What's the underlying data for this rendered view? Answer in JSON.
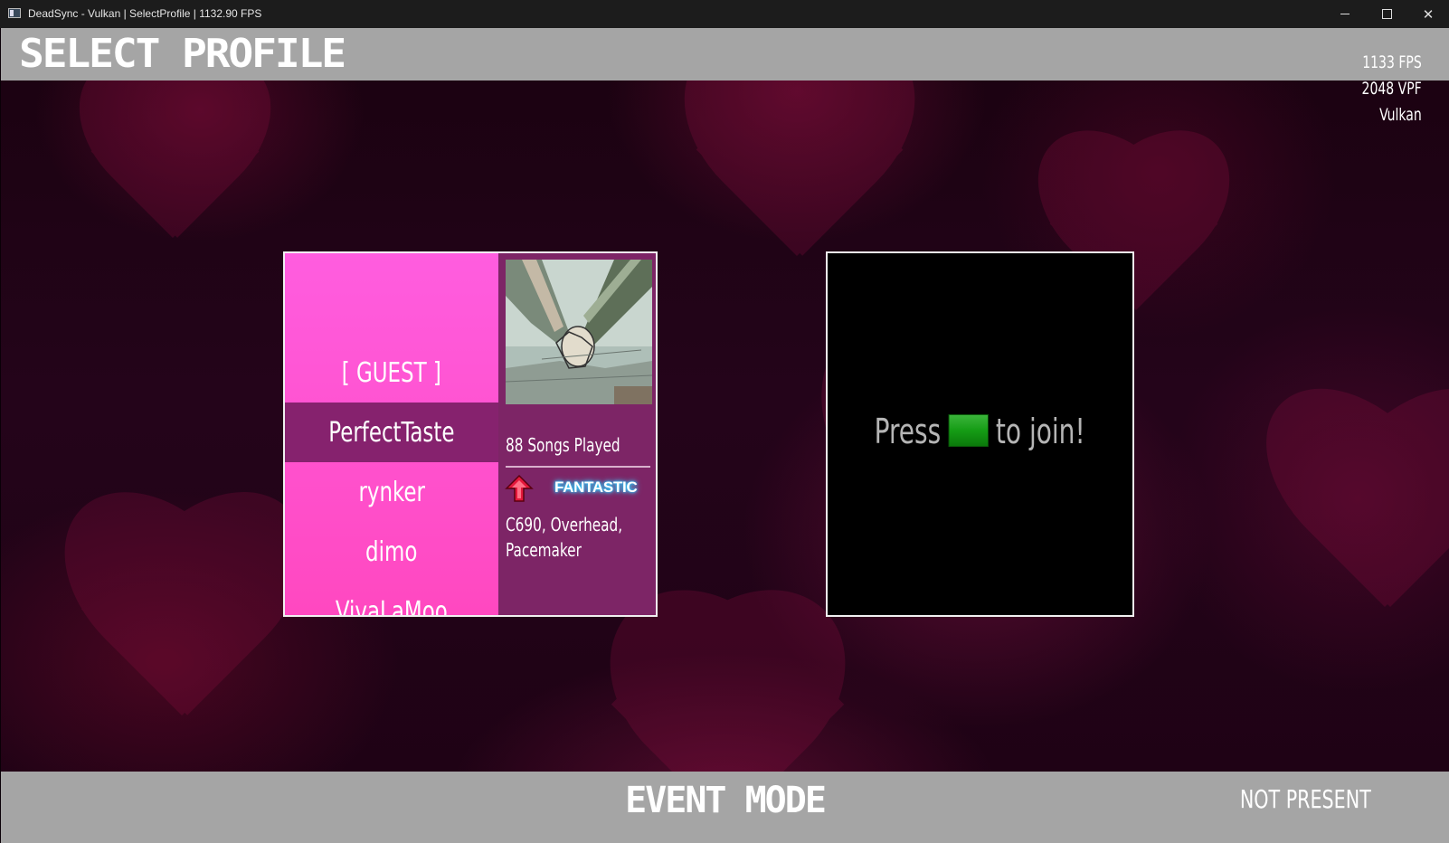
{
  "window": {
    "title": "DeadSync - Vulkan | SelectProfile | 1132.90 FPS",
    "icon": "app-window-icon",
    "controls": {
      "minimize": "minimize-icon",
      "maximize": "maximize-icon",
      "close": "close-icon"
    }
  },
  "header": {
    "title": "SELECT PROFILE",
    "stats": {
      "fps": "1133 FPS",
      "vpf": "2048 VPF",
      "renderer": "Vulkan"
    }
  },
  "player1": {
    "profiles": [
      "[ GUEST ]",
      "PerfectTaste",
      "rynker",
      "dimo",
      "VivaLaMoo"
    ],
    "selected_index": 1,
    "selected_profile": {
      "songs_played": "88 Songs Played",
      "judgment_icon": "red-up-arrow-icon",
      "judgment": "FANTASTIC",
      "mods": "C690, Overhead, Pacemaker"
    }
  },
  "player2": {
    "join_prefix": "Press",
    "join_button_icon": "green-start-button-icon",
    "join_suffix": "to join!"
  },
  "footer": {
    "mode": "EVENT MODE",
    "p2_status": "NOT PRESENT"
  },
  "colors": {
    "bar": "#a5a5a5",
    "profile_list": "#ff4fc8",
    "selected_row": "#86226e",
    "info_panel": "#7d2566",
    "start_button": "#16a016",
    "judgment_glow": "#38d4ff"
  }
}
